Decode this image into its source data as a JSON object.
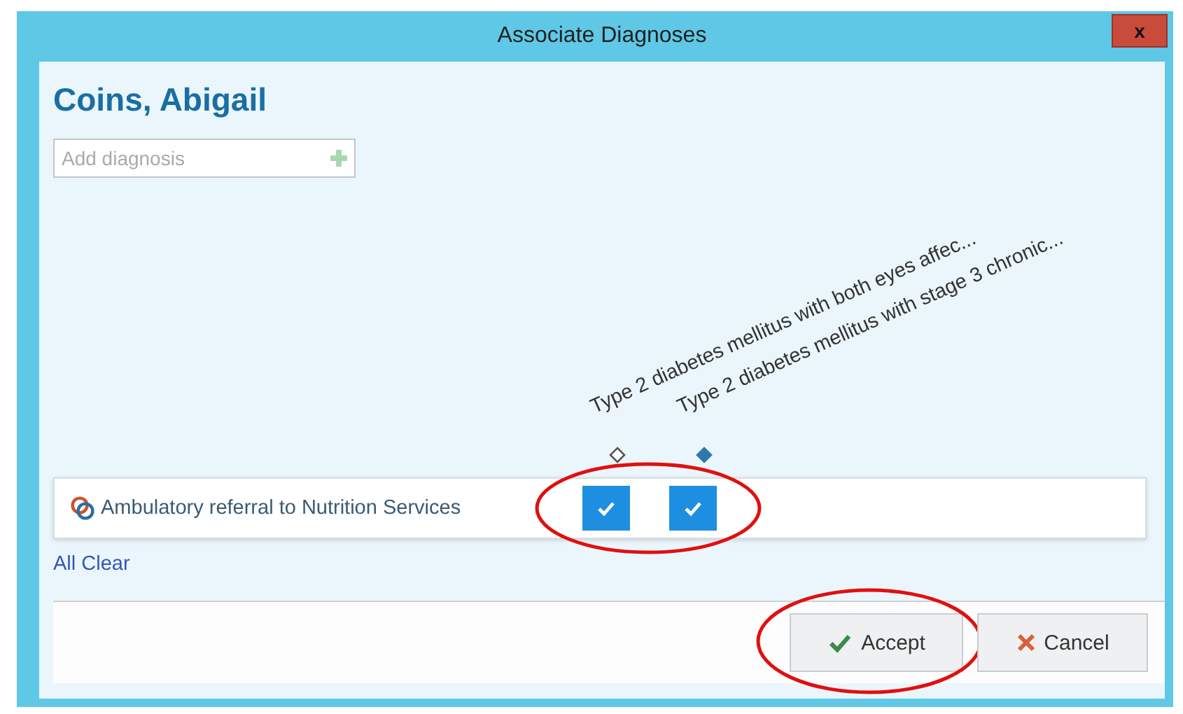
{
  "window": {
    "title": "Associate Diagnoses",
    "close": "x"
  },
  "patient": {
    "name": "Coins, Abigail"
  },
  "search": {
    "placeholder": "Add diagnosis"
  },
  "diagnoses": [
    {
      "label": "Type 2 diabetes mellitus with both eyes affec...",
      "primary": false
    },
    {
      "label": "Type 2 diabetes mellitus with stage 3 chronic...",
      "primary": true
    }
  ],
  "orders": [
    {
      "name": "Ambulatory referral to Nutrition Services",
      "checks": [
        true,
        true
      ],
      "circled": true
    }
  ],
  "links": [
    "All Clear"
  ],
  "buttons": [
    {
      "kind": "accept",
      "label": "Accept",
      "circled": true
    },
    {
      "kind": "cancel",
      "label": "Cancel",
      "circled": false
    }
  ]
}
